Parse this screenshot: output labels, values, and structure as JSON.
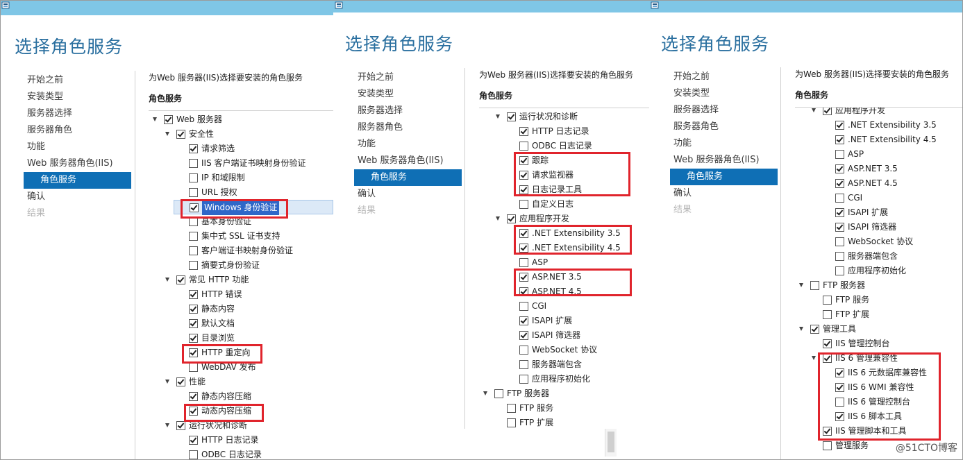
{
  "page_title": "选择角色服务",
  "description": "为Web 服务器(IIS)选择要安装的角色服务",
  "subheading": "角色服务",
  "nav": [
    {
      "label": "开始之前",
      "state": "normal"
    },
    {
      "label": "安装类型",
      "state": "normal"
    },
    {
      "label": "服务器选择",
      "state": "normal"
    },
    {
      "label": "服务器角色",
      "state": "normal"
    },
    {
      "label": "功能",
      "state": "normal"
    },
    {
      "label": "Web 服务器角色(IIS)",
      "state": "normal"
    },
    {
      "label": "角色服务",
      "state": "selected"
    },
    {
      "label": "确认",
      "state": "normal"
    },
    {
      "label": "结果",
      "state": "disabled"
    }
  ],
  "panels": [
    {
      "tree": [
        {
          "label": "Web 服务器",
          "level": 0,
          "expanded": true,
          "checked": true
        },
        {
          "label": "安全性",
          "level": 1,
          "expanded": true,
          "checked": true
        },
        {
          "label": "请求筛选",
          "level": 2,
          "checked": true
        },
        {
          "label": "IIS 客户端证书映射身份验证",
          "level": 2,
          "checked": false
        },
        {
          "label": "IP 和域限制",
          "level": 2,
          "checked": false
        },
        {
          "label": "URL 授权",
          "level": 2,
          "checked": false
        },
        {
          "label": "Windows 身份验证",
          "level": 2,
          "checked": true,
          "selected": true
        },
        {
          "label": "基本身份验证",
          "level": 2,
          "checked": false
        },
        {
          "label": "集中式 SSL 证书支持",
          "level": 2,
          "checked": false
        },
        {
          "label": "客户端证书映射身份验证",
          "level": 2,
          "checked": false
        },
        {
          "label": "摘要式身份验证",
          "level": 2,
          "checked": false
        },
        {
          "label": "常见 HTTP 功能",
          "level": 1,
          "expanded": true,
          "checked": true
        },
        {
          "label": "HTTP 错误",
          "level": 2,
          "checked": true
        },
        {
          "label": "静态内容",
          "level": 2,
          "checked": true
        },
        {
          "label": "默认文档",
          "level": 2,
          "checked": true
        },
        {
          "label": "目录浏览",
          "level": 2,
          "checked": true
        },
        {
          "label": "HTTP 重定向",
          "level": 2,
          "checked": true
        },
        {
          "label": "WebDAV 发布",
          "level": 2,
          "checked": false
        },
        {
          "label": "性能",
          "level": 1,
          "expanded": true,
          "checked": true
        },
        {
          "label": "静态内容压缩",
          "level": 2,
          "checked": true
        },
        {
          "label": "动态内容压缩",
          "level": 2,
          "checked": true
        },
        {
          "label": "运行状况和诊断",
          "level": 1,
          "expanded": true,
          "checked": true
        },
        {
          "label": "HTTP 日志记录",
          "level": 2,
          "checked": true
        },
        {
          "label": "ODBC 日志记录",
          "level": 2,
          "checked": false
        }
      ]
    },
    {
      "tree": [
        {
          "label": "运行状况和诊断",
          "level": 1,
          "expanded": true,
          "checked": true
        },
        {
          "label": "HTTP 日志记录",
          "level": 2,
          "checked": true
        },
        {
          "label": "ODBC 日志记录",
          "level": 2,
          "checked": false
        },
        {
          "label": "跟踪",
          "level": 2,
          "checked": true
        },
        {
          "label": "请求监视器",
          "level": 2,
          "checked": true
        },
        {
          "label": "日志记录工具",
          "level": 2,
          "checked": true
        },
        {
          "label": "自定义日志",
          "level": 2,
          "checked": false
        },
        {
          "label": "应用程序开发",
          "level": 1,
          "expanded": true,
          "checked": true
        },
        {
          "label": ".NET Extensibility 3.5",
          "level": 2,
          "checked": true
        },
        {
          "label": ".NET Extensibility 4.5",
          "level": 2,
          "checked": true
        },
        {
          "label": "ASP",
          "level": 2,
          "checked": false
        },
        {
          "label": "ASP.NET 3.5",
          "level": 2,
          "checked": true
        },
        {
          "label": "ASP.NET 4.5",
          "level": 2,
          "checked": true
        },
        {
          "label": "CGI",
          "level": 2,
          "checked": false
        },
        {
          "label": "ISAPI 扩展",
          "level": 2,
          "checked": true
        },
        {
          "label": "ISAPI 筛选器",
          "level": 2,
          "checked": true
        },
        {
          "label": "WebSocket 协议",
          "level": 2,
          "checked": false
        },
        {
          "label": "服务器端包含",
          "level": 2,
          "checked": false
        },
        {
          "label": "应用程序初始化",
          "level": 2,
          "checked": false
        },
        {
          "label": "FTP 服务器",
          "level": 0,
          "expanded": true,
          "checked": false
        },
        {
          "label": "FTP 服务",
          "level": 1,
          "checked": false
        },
        {
          "label": "FTP 扩展",
          "level": 1,
          "checked": false
        }
      ]
    },
    {
      "tree": [
        {
          "label": "应用程序开发",
          "level": 1,
          "expanded": true,
          "checked": true
        },
        {
          "label": ".NET Extensibility 3.5",
          "level": 2,
          "checked": true
        },
        {
          "label": ".NET Extensibility 4.5",
          "level": 2,
          "checked": true
        },
        {
          "label": "ASP",
          "level": 2,
          "checked": false
        },
        {
          "label": "ASP.NET 3.5",
          "level": 2,
          "checked": true
        },
        {
          "label": "ASP.NET 4.5",
          "level": 2,
          "checked": true
        },
        {
          "label": "CGI",
          "level": 2,
          "checked": false
        },
        {
          "label": "ISAPI 扩展",
          "level": 2,
          "checked": true
        },
        {
          "label": "ISAPI 筛选器",
          "level": 2,
          "checked": true
        },
        {
          "label": "WebSocket 协议",
          "level": 2,
          "checked": false
        },
        {
          "label": "服务器端包含",
          "level": 2,
          "checked": false
        },
        {
          "label": "应用程序初始化",
          "level": 2,
          "checked": false
        },
        {
          "label": "FTP 服务器",
          "level": 0,
          "expanded": true,
          "checked": false
        },
        {
          "label": "FTP 服务",
          "level": 1,
          "checked": false
        },
        {
          "label": "FTP 扩展",
          "level": 1,
          "checked": false
        },
        {
          "label": "管理工具",
          "level": 0,
          "expanded": true,
          "checked": true
        },
        {
          "label": "IIS 管理控制台",
          "level": 1,
          "checked": true
        },
        {
          "label": "IIS 6 管理兼容性",
          "level": 1,
          "expanded": true,
          "checked": true
        },
        {
          "label": "IIS 6 元数据库兼容性",
          "level": 2,
          "checked": true
        },
        {
          "label": "IIS 6 WMI 兼容性",
          "level": 2,
          "checked": true
        },
        {
          "label": "IIS 6 管理控制台",
          "level": 2,
          "checked": false
        },
        {
          "label": "IIS 6 脚本工具",
          "level": 2,
          "checked": true
        },
        {
          "label": "IIS 管理脚本和工具",
          "level": 1,
          "checked": true
        },
        {
          "label": "管理服务",
          "level": 1,
          "checked": false
        }
      ]
    }
  ],
  "watermark": "@51CTO博客",
  "colors": {
    "titlebar": "#7fc6e6",
    "title_text": "#2a6f9f",
    "nav_selected": "#0f6fb5",
    "highlight_box": "#e0242c"
  }
}
